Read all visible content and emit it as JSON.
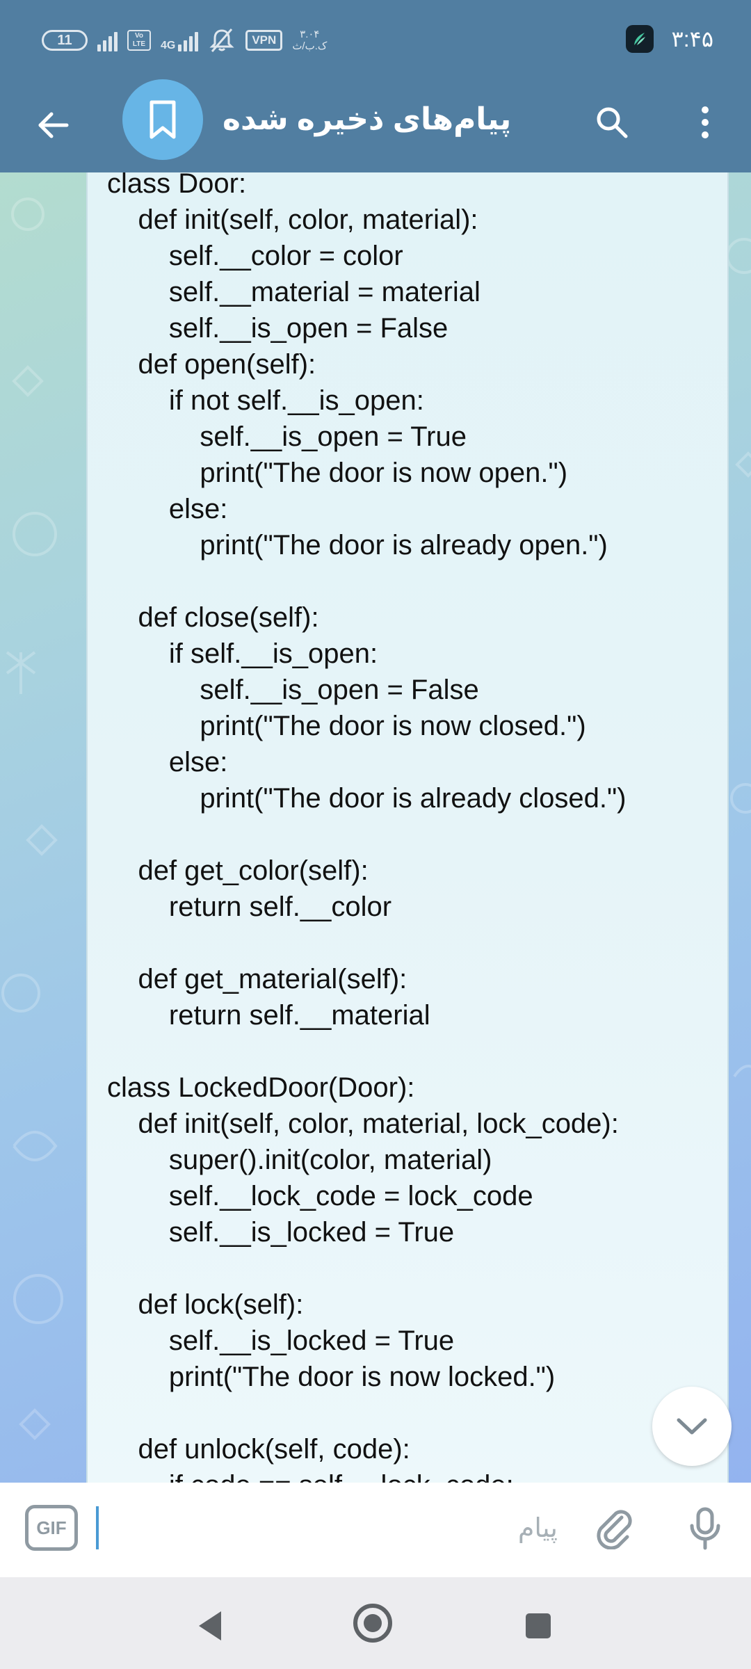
{
  "status_bar": {
    "battery_level": "11",
    "volte_label": "Vo LTE",
    "network_label": "4G",
    "vpn_label": "VPN",
    "data_speed_value": "۳.۰۴",
    "data_speed_unit": "ک.ب/ث",
    "time": "۳:۴۵"
  },
  "app_bar": {
    "title": "پیام‌های ذخیره شده",
    "back_icon": "arrow-left-icon",
    "avatar_icon": "bookmark-icon",
    "search_icon": "search-icon",
    "more_icon": "more-vertical-icon"
  },
  "message": {
    "code_lines": [
      "class Door:",
      "    def init(self, color, material):",
      "        self.__color = color",
      "        self.__material = material",
      "        self.__is_open = False",
      "    def open(self):",
      "        if not self.__is_open:",
      "            self.__is_open = True",
      "            print(\"The door is now open.\")",
      "        else:",
      "            print(\"The door is already open.\")",
      "",
      "    def close(self):",
      "        if self.__is_open:",
      "            self.__is_open = False",
      "            print(\"The door is now closed.\")",
      "        else:",
      "            print(\"The door is already closed.\")",
      "",
      "    def get_color(self):",
      "        return self.__color",
      "",
      "    def get_material(self):",
      "        return self.__material",
      "",
      "class LockedDoor(Door):",
      "    def init(self, color, material, lock_code):",
      "        super().init(color, material)",
      "        self.__lock_code = lock_code",
      "        self.__is_locked = True",
      "",
      "    def lock(self):",
      "        self.__is_locked = True",
      "        print(\"The door is now locked.\")",
      "",
      "    def unlock(self, code):",
      "        if code == self.__lock_code:"
    ]
  },
  "input_bar": {
    "gif_label": "GIF",
    "placeholder": "پیام",
    "attach_icon": "paperclip-icon",
    "mic_icon": "microphone-icon"
  },
  "nav_bar": {
    "back_icon": "triangle-back-icon",
    "home_icon": "home-circle-icon",
    "recents_icon": "square-recents-icon"
  },
  "colors": {
    "header": "#517ea1",
    "avatar": "#67b5e6",
    "bubble": "#e6f4f8",
    "cursor": "#4a9ad4"
  }
}
